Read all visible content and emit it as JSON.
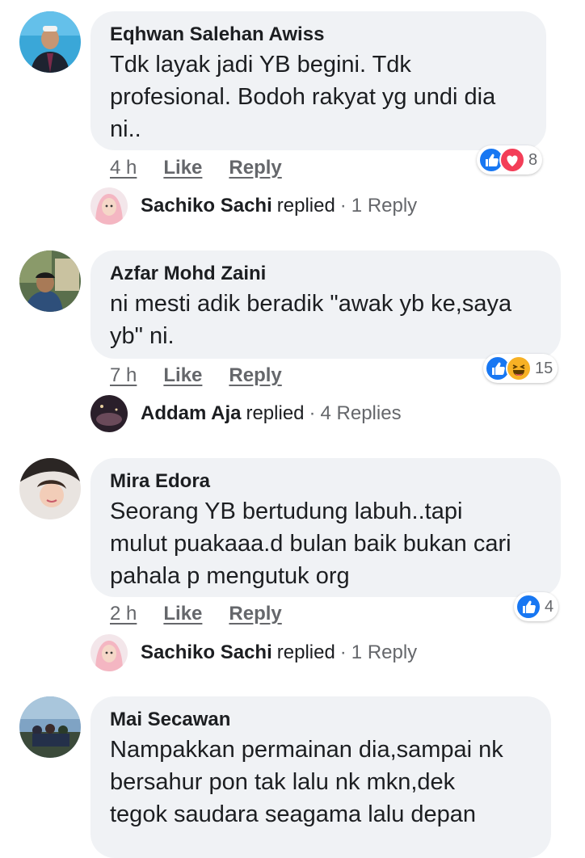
{
  "comments": [
    {
      "author": "Eqhwan Salehan Awiss",
      "lines": [
        "Tdk layak jadi YB begini. Tdk",
        "profesional. Bodoh rakyat yg undi dia",
        "ni.."
      ],
      "time": "4 h",
      "like": "Like",
      "reply": "Reply",
      "reaction_count": "8",
      "reaction_icons": [
        "like-icon",
        "love-icon"
      ],
      "replied": {
        "name": "Sachiko Sachi",
        "verb": "replied",
        "sep": "·",
        "count": "1 Reply"
      }
    },
    {
      "author": "Azfar Mohd Zaini",
      "lines": [
        "ni mesti adik beradik \"awak yb ke,saya",
        "yb\" ni."
      ],
      "time": "7 h",
      "like": "Like",
      "reply": "Reply",
      "reaction_count": "15",
      "reaction_icons": [
        "like-icon",
        "haha-icon"
      ],
      "replied": {
        "name": "Addam Aja",
        "verb": "replied",
        "sep": "·",
        "count": "4 Replies"
      }
    },
    {
      "author": "Mira Edora",
      "lines": [
        "Seorang YB bertudung labuh..tapi",
        "mulut puakaaa.d bulan baik bukan cari",
        "pahala p mengutuk org"
      ],
      "time": "2 h",
      "like": "Like",
      "reply": "Reply",
      "reaction_count": "4",
      "reaction_icons": [
        "like-icon"
      ],
      "replied": {
        "name": "Sachiko Sachi",
        "verb": "replied",
        "sep": "·",
        "count": "1 Reply"
      }
    },
    {
      "author": "Mai Secawan",
      "lines": [
        "Nampakkan permainan dia,sampai nk",
        "bersahur pon tak lalu nk mkn,dek",
        "tegok saudara seagama lalu depan"
      ]
    }
  ],
  "colors": {
    "bubble": "#f0f2f5",
    "like_blue": "#1877f2",
    "love_red": "#f33e58",
    "haha_yellow": "#f7b125",
    "meta_gray": "#65676b"
  }
}
